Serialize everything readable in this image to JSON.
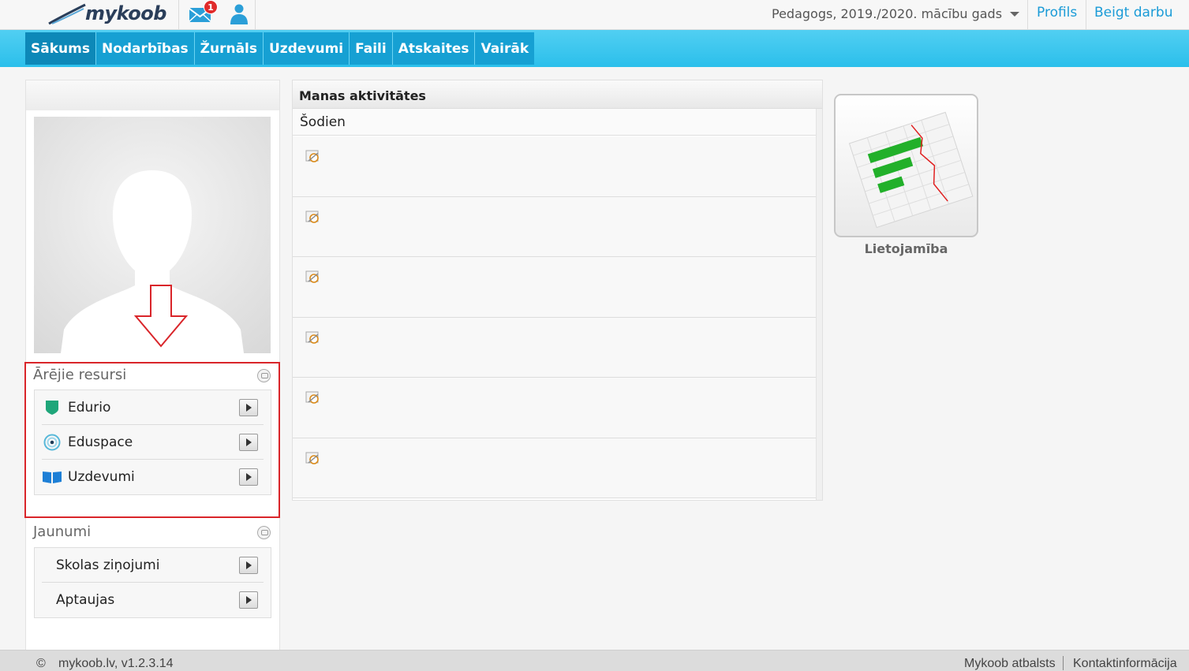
{
  "header": {
    "logo_text": "mykoob",
    "mail_badge": "1",
    "role_selector": "Pedagogs, 2019./2020. mācību gads",
    "profile_link": "Profils",
    "logout_link": "Beigt darbu"
  },
  "nav": {
    "items": [
      "Sākums",
      "Nodarbības",
      "Žurnāls",
      "Uzdevumi",
      "Faili",
      "Atskaites",
      "Vairāk"
    ],
    "active": "Sākums"
  },
  "sidebar": {
    "external_resources": {
      "title": "Ārējie resursi",
      "items": [
        {
          "label": "Edurio",
          "icon": "shield-icon"
        },
        {
          "label": "Eduspace",
          "icon": "target-icon"
        },
        {
          "label": "Uzdevumi",
          "icon": "book-icon"
        }
      ]
    },
    "news": {
      "title": "Jaunumi",
      "items": [
        {
          "label": "Skolas ziņojumi"
        },
        {
          "label": "Aptaujas"
        }
      ]
    }
  },
  "activities": {
    "title": "Manas aktivitātes",
    "today_label": "Šodien",
    "row_count": 6
  },
  "apps": {
    "tile_label": "Lietojamība"
  },
  "footer": {
    "copyright_symbol": "©",
    "version": "mykoob.lv, v1.2.3.14",
    "support_link": "Mykoob atbalsts",
    "contact_link": "Kontaktinformācija"
  },
  "colors": {
    "accent": "#1a9bd7",
    "nav_bg": "#16a0d3",
    "highlight": "#d9252a"
  }
}
